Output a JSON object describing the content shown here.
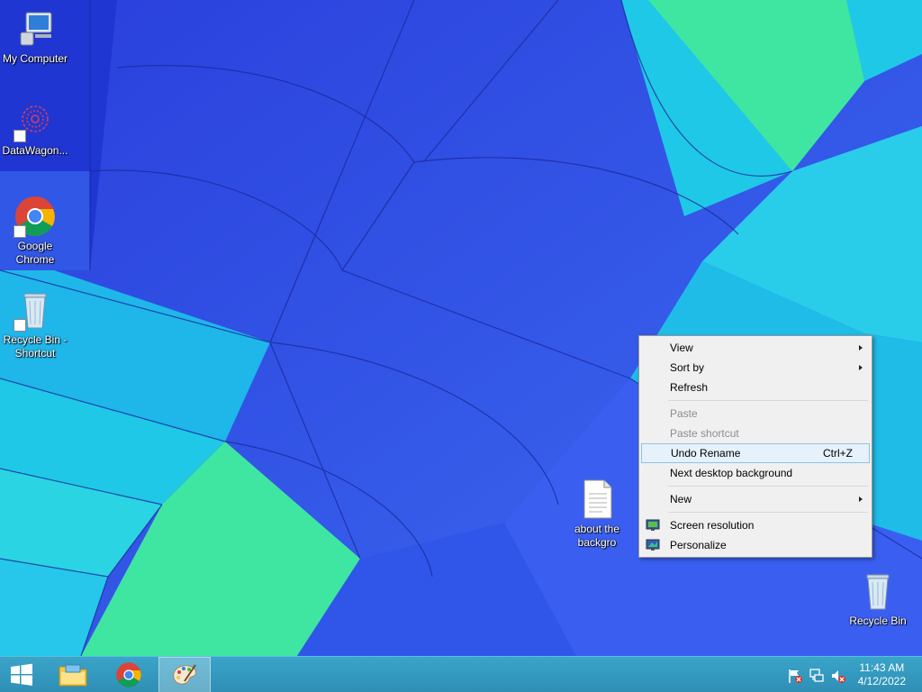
{
  "desktop": {
    "icons": [
      {
        "label": "My Computer"
      },
      {
        "label": "DataWagon..."
      },
      {
        "label": "Google Chrome"
      },
      {
        "label": "Recycle Bin - Shortcut"
      },
      {
        "label": "about the backgro"
      },
      {
        "label": "Recycle Bin"
      }
    ]
  },
  "context_menu": {
    "items": [
      {
        "label": "View"
      },
      {
        "label": "Sort by"
      },
      {
        "label": "Refresh"
      },
      {
        "label": "Paste"
      },
      {
        "label": "Paste shortcut"
      },
      {
        "label": "Undo Rename",
        "shortcut": "Ctrl+Z"
      },
      {
        "label": "Next desktop background"
      },
      {
        "label": "New"
      },
      {
        "label": "Screen resolution"
      },
      {
        "label": "Personalize"
      }
    ]
  },
  "taskbar": {
    "clock_time": "11:43 AM",
    "clock_date": "4/12/2022",
    "icons": [
      "windows-start-icon",
      "file-explorer-icon",
      "chrome-icon",
      "paint-icon"
    ],
    "tray_icons": [
      "action-center-flag-icon",
      "network-icon",
      "volume-muted-icon"
    ]
  },
  "colors": {
    "wallpaper_blue": "#2b4fd9",
    "wallpaper_cyan": "#1fc8e6",
    "wallpaper_green": "#3fe6a2",
    "taskbar": "#2f8fb5",
    "menu_highlight": "#e5f1fb"
  }
}
